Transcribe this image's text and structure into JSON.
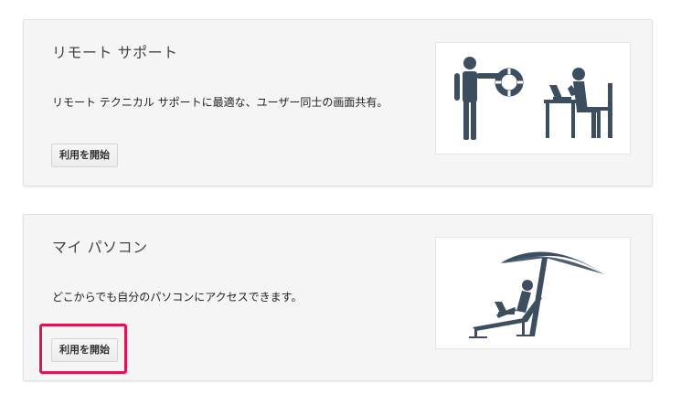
{
  "cards": [
    {
      "title": "リモート サポート",
      "description": "リモート テクニカル サポートに最適な、ユーザー同士の画面共有。",
      "button_label": "利用を開始",
      "illustration": "lifebuoy-helper-icon"
    },
    {
      "title": "マイ パソコン",
      "description": "どこからでも自分のパソコンにアクセスできます。",
      "button_label": "利用を開始",
      "illustration": "beach-laptop-icon"
    }
  ],
  "colors": {
    "illustration": "#3c4e60",
    "highlight": "#e2134f",
    "card_bg": "#f5f5f5"
  }
}
